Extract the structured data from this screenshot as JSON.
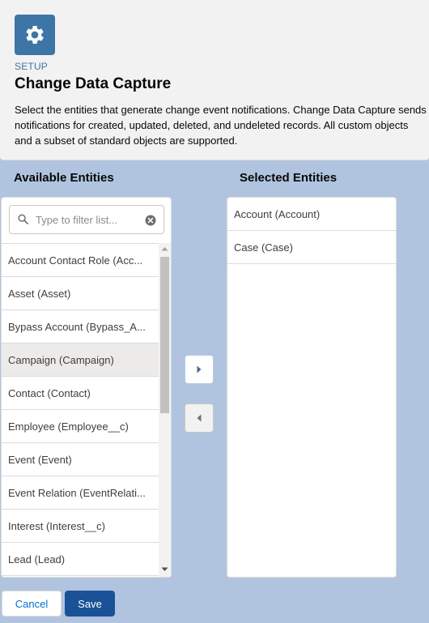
{
  "header": {
    "icon": "gear-icon",
    "eyebrow": "SETUP",
    "title": "Change Data Capture",
    "description": "Select the entities that generate change event notifications. Change Data Capture sends notifications for created, updated, deleted, and undeleted records. All custom objects and a subset of standard objects are supported."
  },
  "available": {
    "label": "Available Entities",
    "search_placeholder": "Type to filter list...",
    "search_value": "",
    "items": [
      {
        "label": "Account Contact Role (Acc..."
      },
      {
        "label": "Asset (Asset)"
      },
      {
        "label": "Bypass Account (Bypass_A..."
      },
      {
        "label": "Campaign (Campaign)",
        "selected": true
      },
      {
        "label": "Contact (Contact)"
      },
      {
        "label": "Employee (Employee__c)"
      },
      {
        "label": "Event (Event)"
      },
      {
        "label": "Event Relation (EventRelati..."
      },
      {
        "label": "Interest (Interest__c)"
      },
      {
        "label": "Lead (Lead)"
      }
    ]
  },
  "selected": {
    "label": "Selected Entities",
    "items": [
      {
        "label": "Account (Account)"
      },
      {
        "label": "Case (Case)"
      }
    ]
  },
  "buttons": {
    "cancel": "Cancel",
    "save": "Save"
  },
  "colors": {
    "page_background": "#b0c4df",
    "brand": "#3e75a7",
    "save_button": "#1b5297",
    "link": "#0070d2"
  }
}
